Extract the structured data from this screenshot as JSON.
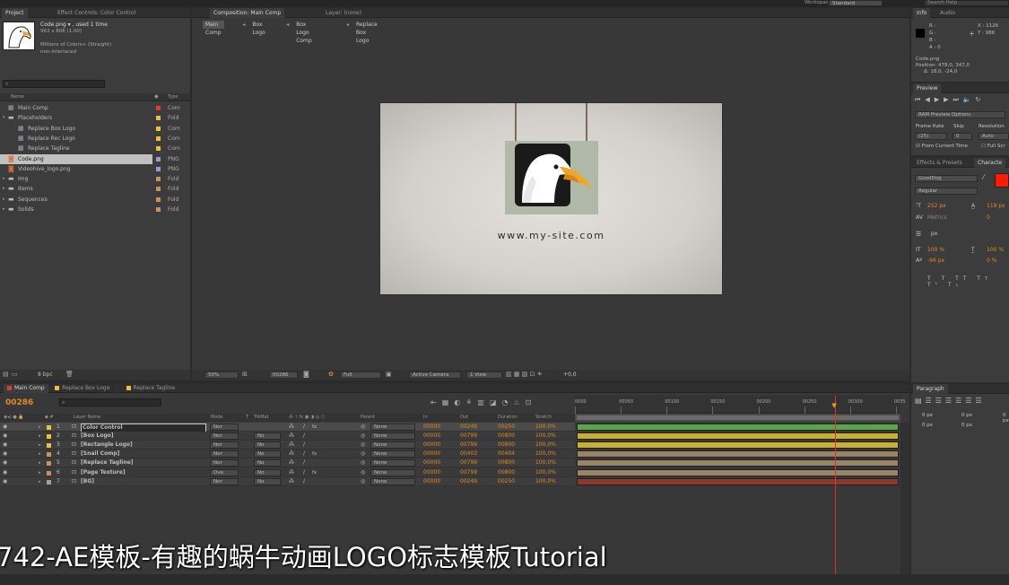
{
  "topbar": {
    "workspace_label": "Workspace:",
    "workspace_value": "Standard",
    "search_placeholder": "Search Help"
  },
  "left_panel": {
    "tabs": {
      "project": "Project",
      "effect_controls": "Effect Controls: Color Control"
    },
    "asset": {
      "name": "Code.png ▾ , used 1 time",
      "dims": "963 x 806 (1.00)",
      "colors": "Millions of Colors+ (Straight)",
      "interlace": "non-interlaced"
    },
    "headers": {
      "name": "Name",
      "type": "Type"
    },
    "items": [
      {
        "label": "Main Comp",
        "type": "Com",
        "color": "#e23a3a",
        "indent": 0,
        "kind": "comp"
      },
      {
        "label": "Placeholders",
        "type": "Fold",
        "color": "#e8c23a",
        "indent": 0,
        "kind": "folder",
        "open": true
      },
      {
        "label": "Replace Box Logo",
        "type": "Com",
        "color": "#e8c23a",
        "indent": 1,
        "kind": "comp"
      },
      {
        "label": "Replace Rec Logo",
        "type": "Com",
        "color": "#e8c23a",
        "indent": 1,
        "kind": "comp"
      },
      {
        "label": "Replace Tagline",
        "type": "Com",
        "color": "#e8c23a",
        "indent": 1,
        "kind": "comp"
      },
      {
        "label": "Code.png",
        "type": "PNG",
        "color": "#9a9ad0",
        "indent": 0,
        "kind": "file",
        "selected": true
      },
      {
        "label": "Videohive_logo.png",
        "type": "PNG",
        "color": "#9a9ad0",
        "indent": 0,
        "kind": "file"
      },
      {
        "label": "Img",
        "type": "Fold",
        "color": "#c8925a",
        "indent": 0,
        "kind": "folder"
      },
      {
        "label": "Items",
        "type": "Fold",
        "color": "#c8925a",
        "indent": 0,
        "kind": "folder"
      },
      {
        "label": "Sequences",
        "type": "Fold",
        "color": "#c8925a",
        "indent": 0,
        "kind": "folder"
      },
      {
        "label": "Solids",
        "type": "Fold",
        "color": "#c8925a",
        "indent": 0,
        "kind": "folder"
      }
    ],
    "bpc": "8 bpc"
  },
  "comp_panel": {
    "tabs": {
      "composition": "Composition: Main Comp",
      "layer": "Layer: (none)"
    },
    "breadcrumbs": [
      "Main Comp",
      "Box Logo",
      "Box Logo Comp",
      "Replace Box Logo"
    ],
    "site_text": "www.my-site.com",
    "toolbar": {
      "zoom": "50%",
      "timecode": "00286",
      "quality": "Full",
      "camera": "Active Camera",
      "view": "1 View",
      "exposure": "+0,0"
    }
  },
  "info_panel": {
    "tabs": {
      "info": "Info",
      "audio": "Audio"
    },
    "rgb": [
      "R :",
      "G :",
      "B :",
      "A : 0"
    ],
    "xy": [
      "X : 1126",
      "Y : 986"
    ],
    "file": "Code.png",
    "position": "Position: 478,0, 347,0",
    "delta": "Δ: 18,0, -24,0"
  },
  "preview_panel": {
    "tab": "Preview",
    "ram": "RAM Preview Options",
    "labels": {
      "frame_rate": "Frame Rate",
      "skip": "Skip",
      "resolution": "Resolution"
    },
    "values": {
      "frame_rate": "(25)",
      "skip": "0",
      "resolution": "Auto"
    },
    "from_current": "From Current Time",
    "full_screen": "Full Scr"
  },
  "character_panel": {
    "tabs": {
      "effects": "Effects & Presets",
      "character": "Characte"
    },
    "font": "GoodDog",
    "style": "Regular",
    "size": "252 px",
    "leading": "119 px",
    "kerning": "Metrics",
    "tracking": "0",
    "stroke": "px",
    "vscale": "100 %",
    "hscale": "100 %",
    "baseline": "-96 px",
    "tsume": "0 %",
    "color": "#ff1a00"
  },
  "paragraph_panel": {
    "tab": "Paragraph",
    "indent_values": [
      "0 px",
      "0 px",
      "0 px",
      "0 px",
      "0 px"
    ]
  },
  "timeline": {
    "tabs": [
      "Main Comp",
      "Replace Box Logo",
      "Replace Tagline"
    ],
    "timecode": "00286",
    "headers": {
      "layer_name": "Layer Name",
      "mode": "Mode",
      "t": "T",
      "trkmat": "TrkMat",
      "parent": "Parent",
      "in": "In",
      "out": "Out",
      "duration": "Duration",
      "stretch": "Stretch"
    },
    "ruler": [
      "0000",
      "00050",
      "00100",
      "00150",
      "00200",
      "00250",
      "00300",
      "0035"
    ],
    "playhead_frac": 0.8,
    "layers": [
      {
        "num": "1",
        "name": "Color Control",
        "mode": "Nor",
        "trkmat": "",
        "parent": "None",
        "in": "00000",
        "out": "00249",
        "duration": "00250",
        "stretch": "100,0%",
        "color": "#e8c23a",
        "bar": "#59a64a",
        "fx": true,
        "selected": true
      },
      {
        "num": "2",
        "name": "[Box Logo]",
        "mode": "Nor",
        "trkmat": "No",
        "parent": "None",
        "in": "00000",
        "out": "00799",
        "duration": "00800",
        "stretch": "100,0%",
        "color": "#e8c23a",
        "bar": "#c9b02e",
        "fx": false
      },
      {
        "num": "3",
        "name": "[Rectangle Logo]",
        "mode": "Nor",
        "trkmat": "No",
        "parent": "None",
        "in": "00000",
        "out": "00799",
        "duration": "00800",
        "stretch": "100,0%",
        "color": "#e8c23a",
        "bar": "#c9b02e",
        "fx": false
      },
      {
        "num": "4",
        "name": "[Snail Comp]",
        "mode": "Nor",
        "trkmat": "No",
        "parent": "None",
        "in": "00000",
        "out": "00403",
        "duration": "00404",
        "stretch": "100,0%",
        "color": "#c8925a",
        "bar": "#9a8468",
        "fx": true
      },
      {
        "num": "5",
        "name": "[Replace Tagline]",
        "mode": "Nor",
        "trkmat": "No",
        "parent": "None",
        "in": "00000",
        "out": "00799",
        "duration": "00800",
        "stretch": "100,0%",
        "color": "#c8925a",
        "bar": "#9a8468",
        "fx": false
      },
      {
        "num": "6",
        "name": "[Page Texture]",
        "mode": "Ove",
        "trkmat": "No",
        "parent": "None",
        "in": "00000",
        "out": "00799",
        "duration": "00800",
        "stretch": "100,0%",
        "color": "#c8925a",
        "bar": "#9a8468",
        "fx": true
      },
      {
        "num": "7",
        "name": "[BG]",
        "mode": "Nor",
        "trkmat": "No",
        "parent": "None",
        "in": "00000",
        "out": "00249",
        "duration": "00250",
        "stretch": "100,0%",
        "color": "#a0a0a0",
        "bar": "#8a3a2c",
        "fx": false
      }
    ]
  },
  "subtitle": "742-AE模板-有趣的蜗牛动画LOGO标志模板Tutorial"
}
